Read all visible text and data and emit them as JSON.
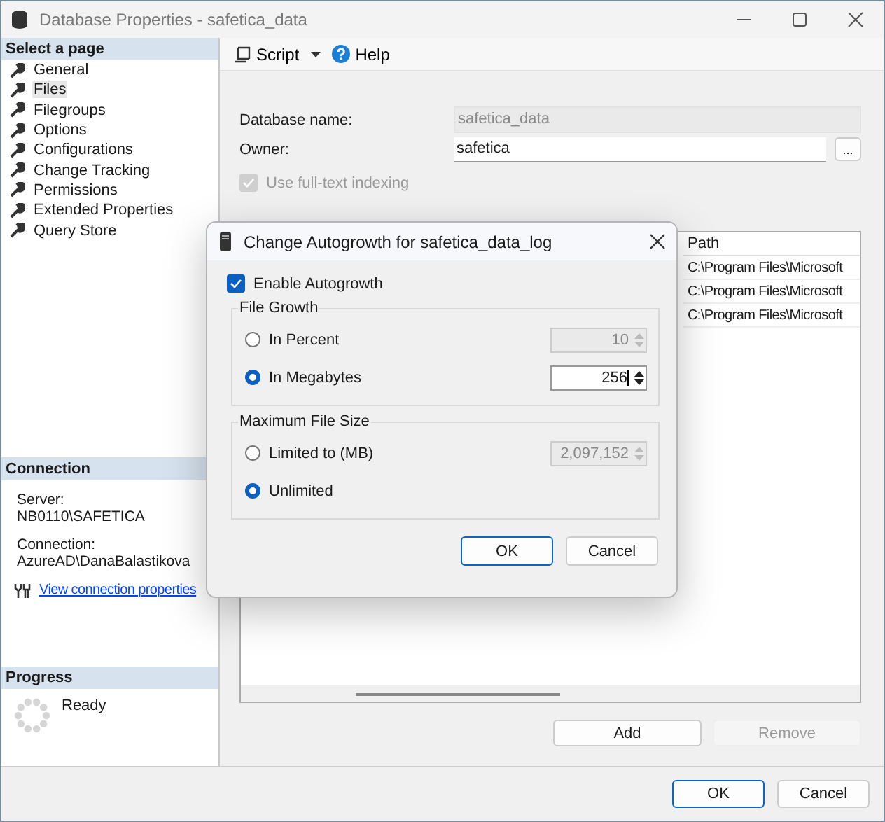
{
  "window": {
    "title": "Database Properties - safetica_data"
  },
  "sidebar": {
    "header": "Select a page",
    "items": [
      {
        "label": "General",
        "selected": false
      },
      {
        "label": "Files",
        "selected": true
      },
      {
        "label": "Filegroups",
        "selected": false
      },
      {
        "label": "Options",
        "selected": false
      },
      {
        "label": "Configurations",
        "selected": false
      },
      {
        "label": "Change Tracking",
        "selected": false
      },
      {
        "label": "Permissions",
        "selected": false
      },
      {
        "label": "Extended Properties",
        "selected": false
      },
      {
        "label": "Query Store",
        "selected": false
      }
    ]
  },
  "connection": {
    "header": "Connection",
    "server_label": "Server:",
    "server": "NB0110\\SAFETICA",
    "connection_label": "Connection:",
    "connection": "AzureAD\\DanaBalastikova",
    "link": "View connection properties"
  },
  "progress": {
    "header": "Progress",
    "status": "Ready"
  },
  "toolbar": {
    "script": "Script",
    "help": "Help"
  },
  "form": {
    "database_name_label": "Database name:",
    "database_name": "safetica_data",
    "owner_label": "Owner:",
    "owner": "safetica",
    "browse": "...",
    "fulltext": {
      "label": "Use full-text indexing",
      "checked": true,
      "disabled": true
    }
  },
  "files_grid": {
    "columns": [
      "Path"
    ],
    "rows": [
      "C:\\Program Files\\Microsoft",
      "C:\\Program Files\\Microsoft",
      "C:\\Program Files\\Microsoft"
    ]
  },
  "grid_buttons": [
    {
      "label": "Add",
      "disabled": false
    },
    {
      "label": "Remove",
      "disabled": true
    }
  ],
  "buttons": [
    {
      "label": "OK",
      "default": true
    },
    {
      "label": "Cancel",
      "default": false
    }
  ],
  "dialog": {
    "title": "Change Autogrowth for safetica_data_log",
    "enable": {
      "label": "Enable Autogrowth",
      "checked": true
    },
    "file_growth": {
      "title": "File Growth",
      "options": [
        {
          "label": "In Percent",
          "selected": false,
          "value": "10"
        },
        {
          "label": "In Megabytes",
          "selected": true,
          "value": "256"
        }
      ]
    },
    "max_size": {
      "title": "Maximum File Size",
      "options": [
        {
          "label": "Limited to (MB)",
          "selected": false,
          "value": "2,097,152"
        },
        {
          "label": "Unlimited",
          "selected": true
        }
      ]
    },
    "buttons": [
      {
        "label": "OK",
        "default": true
      },
      {
        "label": "Cancel",
        "default": false
      }
    ]
  }
}
